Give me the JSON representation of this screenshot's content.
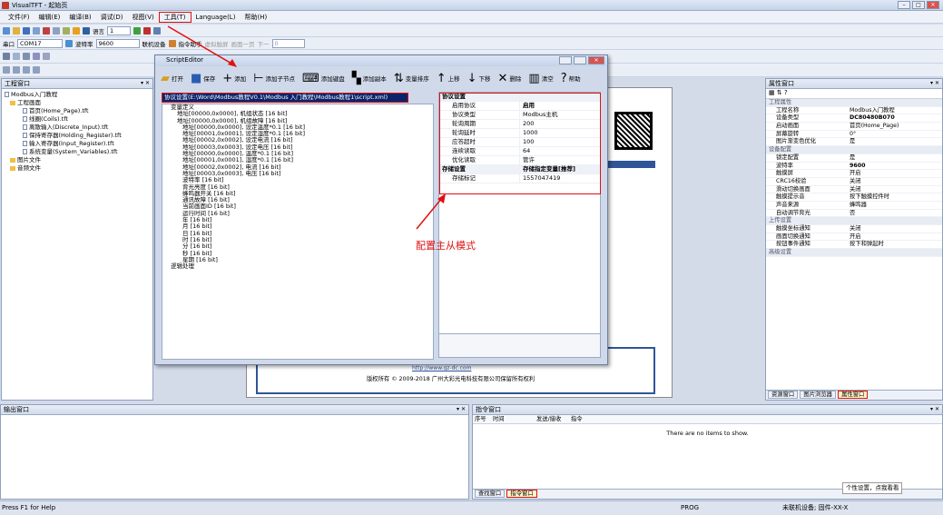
{
  "app": {
    "title": "VisualTFT - 起始页"
  },
  "menu": [
    "文件(F)",
    "编辑(E)",
    "编译(B)",
    "调试(D)",
    "视图(V)",
    "工具(T)",
    "Language(L)",
    "帮助(H)"
  ],
  "toolbar1": {
    "lang_label": "语言",
    "lang_value": "1"
  },
  "toolbar2": {
    "port_label": "串口",
    "port_value": "COM17",
    "baud_label": "波特率",
    "baud_value": "9600",
    "online": "联机设备",
    "cmd_helper": "指令助手",
    "virtual_touch": "虚拟触屏",
    "prev_page": "画面一页",
    "next_page": "下一",
    "value": "0"
  },
  "left_panel": {
    "title": "工程窗口",
    "items": [
      "Modbus入门教程",
      "工程画面",
      "首页(Home_Page).tft",
      "线圈(Coils).tft",
      "离散输入(Discrete_Input).tft",
      "保持寄存器(Holding_Register).tft",
      "输入寄存器(Input_Register).tft",
      "系统变量(System_Variables).tft",
      "图片文件",
      "音频文件"
    ]
  },
  "dialog": {
    "title": "ScriptEditor",
    "buttons": [
      "打开",
      "保存",
      "添加",
      "添加子节点",
      "添加键盘",
      "添加副本",
      "变量排序",
      "上移",
      "下移",
      "删除",
      "清空",
      "帮助"
    ],
    "path": "协议设置(E:\\Word\\Modbus教程V0.1\\Modbus 入门教程\\Modbus教程1\\script.xml)",
    "tree": [
      "变量定义",
      "地址[00000,0x0000], 机组状态 [16 bit]",
      "地址[00000,0x0000], 机组故障 [16 bit]",
      "地址[00000,0x0000], 设定温度*0.1 [16 bit]",
      "地址[00001,0x0001], 设定湿度*0.1 [16 bit]",
      "地址[00002,0x0002], 设定电流 [16 bit]",
      "地址[00003,0x0003], 设定电压 [16 bit]",
      "地址[00000,0x0000], 温度*0.1 [16 bit]",
      "地址[00001,0x0001], 湿度*0.1 [16 bit]",
      "地址[00002,0x0002], 电流 [16 bit]",
      "地址[00003,0x0003], 电压 [16 bit]",
      "波特率 [16 bit]",
      "背光亮度 [16 bit]",
      "蜂鸣器开关 [16 bit]",
      "通讯故障 [16 bit]",
      "当前画面ID [16 bit]",
      "运行时间 [16 bit]",
      "年 [16 bit]",
      "月 [16 bit]",
      "日 [16 bit]",
      "时 [16 bit]",
      "分 [16 bit]",
      "秒 [16 bit]",
      "星期 [16 bit]",
      "逻辑处理"
    ],
    "props": [
      {
        "k": "协议设置",
        "v": "",
        "cat": true
      },
      {
        "k": "启用协议",
        "v": "启用"
      },
      {
        "k": "协议类型",
        "v": "Modbus主机"
      },
      {
        "k": "轮询周期",
        "v": "200"
      },
      {
        "k": "轮询延时",
        "v": "1000"
      },
      {
        "k": "应答超时",
        "v": "100"
      },
      {
        "k": "连续读取",
        "v": "64"
      },
      {
        "k": "优化读取",
        "v": "管许"
      },
      {
        "k": "存储设置",
        "v": "存储指定变量[推荐]",
        "cat": true
      },
      {
        "k": "存储标记",
        "v": "1557047419"
      }
    ]
  },
  "annotation": "配置主从模式",
  "canvas": {
    "url": "http://www.gz-dc.com",
    "copyright": "版权所有 © 2009-2018 广州大彩光电科技有限公司保留所有权利"
  },
  "right_panel": {
    "title": "属性窗口",
    "rows": [
      {
        "k": "工程属性",
        "v": "",
        "cat": true
      },
      {
        "k": "工程名称",
        "v": "Modbus入门教程"
      },
      {
        "k": "设备类型",
        "v": "DC80480B070",
        "b": true
      },
      {
        "k": "启动画面",
        "v": "首页(Home_Page)"
      },
      {
        "k": "屏幕旋转",
        "v": "0°"
      },
      {
        "k": "图片渐变色优化",
        "v": "是"
      },
      {
        "k": "设备配置",
        "v": "",
        "cat": true
      },
      {
        "k": "锁定配置",
        "v": "是"
      },
      {
        "k": "波特率",
        "v": "9600",
        "b": true
      },
      {
        "k": "触摸屏",
        "v": "开启"
      },
      {
        "k": "CRC16校验",
        "v": "关闭"
      },
      {
        "k": "滑动切换画面",
        "v": "关闭"
      },
      {
        "k": "触摸提示音",
        "v": "按下触摸控件时"
      },
      {
        "k": "声音来源",
        "v": "蜂鸣器"
      },
      {
        "k": "自动调节背光",
        "v": "否"
      },
      {
        "k": "上传设置",
        "v": "",
        "cat": true
      },
      {
        "k": "触摸坐标通知",
        "v": "关闭"
      },
      {
        "k": "画面切换通知",
        "v": "开启"
      },
      {
        "k": "按钮事件通知",
        "v": "按下和弹起时"
      },
      {
        "k": "高级设置",
        "v": "",
        "cat": true
      }
    ],
    "tabs": [
      "资源窗口",
      "图片浏览器",
      "属性窗口"
    ]
  },
  "output": {
    "title": "输出窗口"
  },
  "command": {
    "title": "指令窗口",
    "cols": [
      "序号",
      "时间",
      "发送/接收",
      "指令"
    ],
    "empty": "There are no items to show.",
    "tabs": [
      "查找窗口",
      "指令窗口"
    ]
  },
  "status": {
    "left": "Press F1 for Help",
    "mid": "PROG",
    "right": "未联机设备; 固件-XX-X"
  },
  "tooltip": "个性设置，点我看看"
}
